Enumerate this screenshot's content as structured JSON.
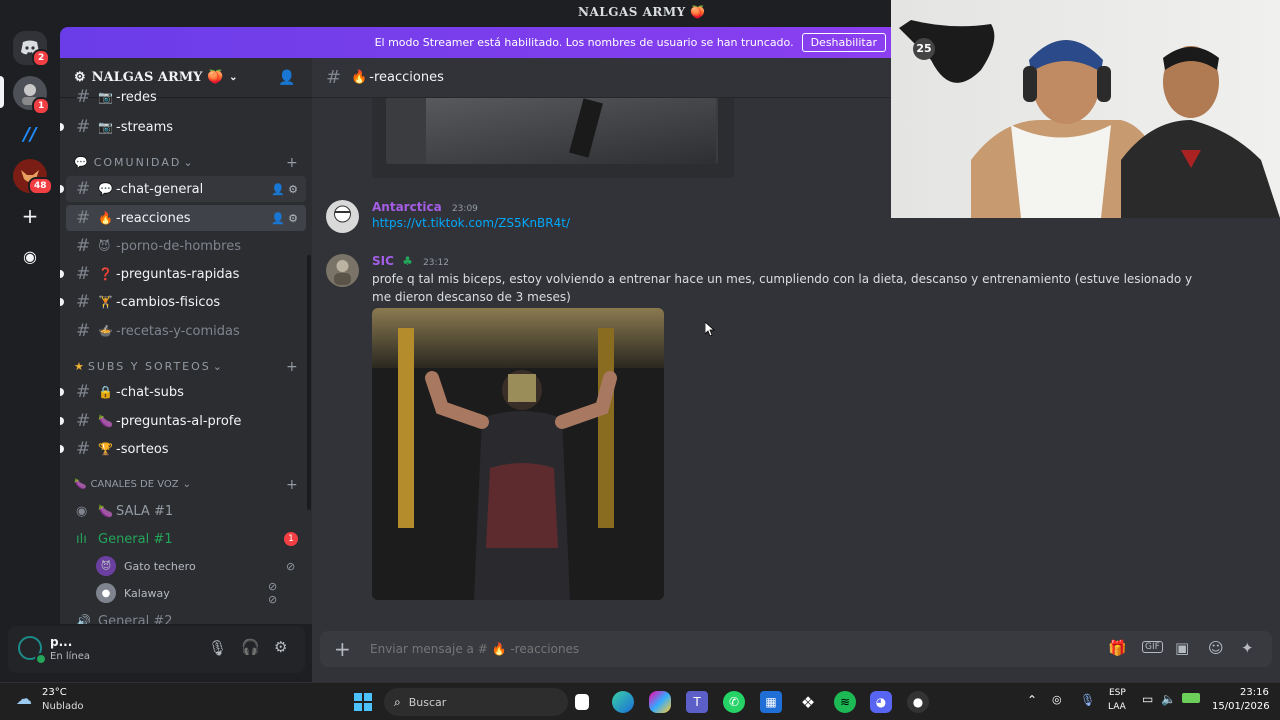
{
  "app": {
    "title": "NALGAS ARMY 🍑"
  },
  "colors": {
    "accent": "#5865f2",
    "streamer_banner": "#7a3eec",
    "link": "#00a8fc",
    "mention_red": "#f23f43",
    "online": "#23a55a",
    "voice_green": "#23a55a"
  },
  "guilds": [
    {
      "icon": "discord-home-icon",
      "badge": "2"
    },
    {
      "icon": "server-avatar-icon",
      "badge": "1"
    },
    {
      "icon": "blue-server-icon"
    },
    {
      "icon": "red-server-icon",
      "badge": "48"
    },
    {
      "icon": "add-server-icon",
      "glyph": "+"
    },
    {
      "icon": "explore-icon",
      "glyph": "◉"
    }
  ],
  "streamer_mode": {
    "message": "El modo Streamer está habilitado. Los nombres de usuario se han truncado.",
    "button": "Deshabilitar"
  },
  "server": {
    "name": "NALGAS ARMY 🍑"
  },
  "channels_top": [
    {
      "emoji": "📷",
      "name": "-redes"
    },
    {
      "emoji": "📷",
      "name": "-streams"
    }
  ],
  "categories": {
    "comunidad": "COMUNIDAD",
    "subs": "SUBS Y SORTEOS",
    "voice": "CANALES DE VOZ"
  },
  "comunidad_channels": [
    {
      "emoji": "💬",
      "name": "-chat-general"
    },
    {
      "emoji": "🔥",
      "name": "-reacciones"
    },
    {
      "emoji": "😈",
      "name": "-porno-de-hombres"
    },
    {
      "emoji": "❓",
      "name": "-preguntas-rapidas"
    },
    {
      "emoji": "🏋",
      "name": "-cambios-fisicos"
    },
    {
      "emoji": "🍲",
      "name": "-recetas-y-comidas"
    }
  ],
  "subs_channels": [
    {
      "emoji": "🔒",
      "name": "-chat-subs"
    },
    {
      "emoji": "🍆",
      "name": "-preguntas-al-profe"
    },
    {
      "emoji": "🏆",
      "name": "-sorteos"
    }
  ],
  "voice_channels": [
    {
      "emoji": "🍆",
      "name": "SALA #1"
    },
    {
      "name": "General #1",
      "badge": "1"
    },
    {
      "name": "General #2"
    }
  ],
  "voice_users": [
    {
      "name": "Gato techero"
    },
    {
      "name": "Kalaway"
    }
  ],
  "user": {
    "name": "p...",
    "status": "En línea"
  },
  "channel_header": {
    "emoji": "🔥",
    "name": "-reacciones"
  },
  "messages": [
    {
      "author": "Antarctica",
      "time": "23:09",
      "link": "https://vt.tiktok.com/ZS5KnBR4t/"
    },
    {
      "author": "SIC",
      "time": "23:12",
      "text": "profe q tal mis biceps, estoy volviendo a entrenar hace un mes, cumpliendo con la dieta, descanso y entrenamiento (estuve lesionado y me dieron descanso de 3 meses)"
    }
  ],
  "composer": {
    "placeholder": "Enviar mensaje a # 🔥 -reacciones"
  },
  "webcam": {
    "badge": "25"
  },
  "taskbar": {
    "weather_temp": "23°C",
    "weather_desc": "Nublado",
    "search": "Buscar",
    "lang": "ESP",
    "layout": "LAA",
    "time": "23:16",
    "date": "15/01/2026"
  }
}
